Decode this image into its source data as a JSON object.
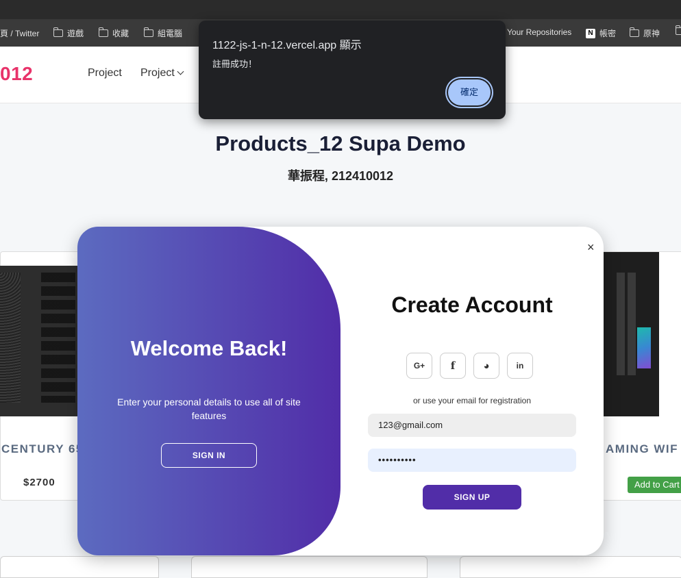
{
  "browser": {
    "bookmarks": [
      {
        "label": "頁 / Twitter",
        "icon": "none"
      },
      {
        "label": "遊戲",
        "icon": "folder-icon"
      },
      {
        "label": "收藏",
        "icon": "folder-icon"
      },
      {
        "label": "組電腦",
        "icon": "folder-icon"
      },
      {
        "label": "Your Repositories",
        "icon": "github-icon"
      },
      {
        "label": "帳密",
        "icon": "notion-icon"
      },
      {
        "label": "原神",
        "icon": "folder-icon"
      }
    ]
  },
  "navbar": {
    "brand": "012",
    "links": [
      {
        "label": "Project"
      },
      {
        "label": "Project",
        "has_dropdown": true
      }
    ]
  },
  "page": {
    "title": "Products_12 Supa Demo",
    "subtitle": "華振程, 212410012"
  },
  "products": [
    {
      "name": "CENTURY 65",
      "price": "$2700"
    },
    {
      "name": "AMING WIF",
      "cart_label": "Add to Cart"
    }
  ],
  "modal": {
    "overlay": {
      "title": "Welcome Back!",
      "text": "Enter your personal details to use all of site features",
      "button": "SIGN IN"
    },
    "form": {
      "title": "Create Account",
      "socials": [
        {
          "icon": "google-plus-icon",
          "glyph": "G+"
        },
        {
          "icon": "facebook-icon",
          "glyph": "f"
        },
        {
          "icon": "github-icon",
          "glyph": "◕"
        },
        {
          "icon": "linkedin-icon",
          "glyph": "in"
        }
      ],
      "or_text": "or use your email for registration",
      "email_value": "123@gmail.com",
      "password_mask": "••••••••••",
      "button": "SIGN UP"
    },
    "close_glyph": "×"
  },
  "alert": {
    "title": "1122-js-1-n-12.vercel.app 顯示",
    "message": "註冊成功！",
    "ok_label": "確定"
  },
  "colors": {
    "brand": "#e8336a",
    "overlay_start": "#5c6bc0",
    "overlay_end": "#512da8",
    "signup_button": "#512da8",
    "add_to_cart": "#43a047",
    "alert_button": "#a8c7fa"
  }
}
